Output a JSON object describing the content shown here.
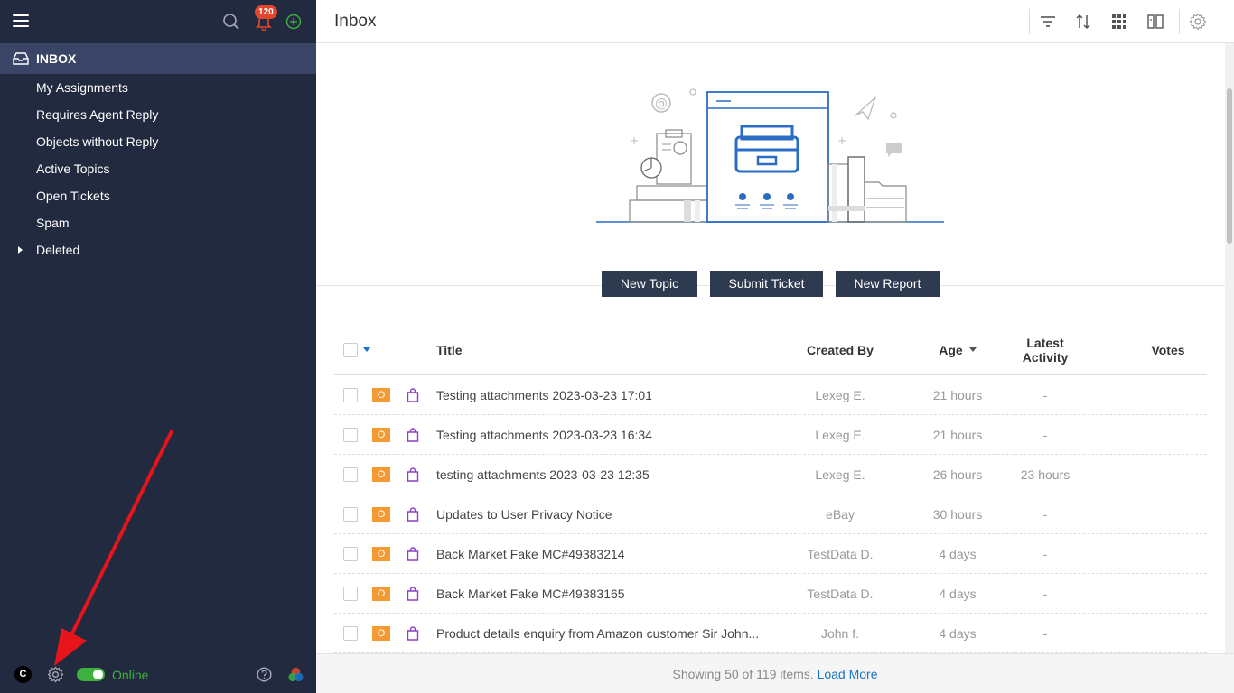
{
  "sidebar": {
    "notification_count": "120",
    "inbox_label": "INBOX",
    "items": [
      {
        "label": "My Assignments"
      },
      {
        "label": "Requires Agent Reply"
      },
      {
        "label": "Objects without Reply"
      },
      {
        "label": "Active Topics"
      },
      {
        "label": "Open Tickets"
      },
      {
        "label": "Spam"
      },
      {
        "label": "Deleted"
      }
    ],
    "avatar_letter": "C",
    "status_label": "Online"
  },
  "header": {
    "title": "Inbox"
  },
  "actions": {
    "new_topic": "New Topic",
    "submit_ticket": "Submit Ticket",
    "new_report": "New Report"
  },
  "table": {
    "columns": {
      "title": "Title",
      "created_by": "Created By",
      "age": "Age",
      "latest_activity": "Latest Activity",
      "votes": "Votes"
    },
    "badge_letter": "O",
    "rows": [
      {
        "title": "Testing attachments 2023-03-23 17:01",
        "created_by": "Lexeg E.",
        "age": "21 hours",
        "latest_activity": "-"
      },
      {
        "title": "Testing attachments 2023-03-23 16:34",
        "created_by": "Lexeg E.",
        "age": "21 hours",
        "latest_activity": "-"
      },
      {
        "title": "testing attachments 2023-03-23 12:35",
        "created_by": "Lexeg E.",
        "age": "26 hours",
        "latest_activity": "23 hours"
      },
      {
        "title": "Updates to User Privacy Notice",
        "created_by": "eBay",
        "age": "30 hours",
        "latest_activity": "-"
      },
      {
        "title": "Back Market Fake MC#49383214",
        "created_by": "TestData D.",
        "age": "4 days",
        "latest_activity": "-"
      },
      {
        "title": "Back Market Fake MC#49383165",
        "created_by": "TestData D.",
        "age": "4 days",
        "latest_activity": "-"
      },
      {
        "title": "Product details enquiry from Amazon customer Sir John...",
        "created_by": "John f.",
        "age": "4 days",
        "latest_activity": "-"
      }
    ]
  },
  "footer": {
    "showing_text": "Showing 50 of 119 items.",
    "load_more": "Load More"
  },
  "colors": {
    "sidebar_bg": "#222a3f",
    "sidebar_active": "#3a4466",
    "button_bg": "#2e3a4f",
    "badge_orange": "#f59a33",
    "online_green": "#3cb13d",
    "link_blue": "#1a73c8",
    "notification_red": "#e4462d",
    "arrow_red": "#e8141b"
  }
}
